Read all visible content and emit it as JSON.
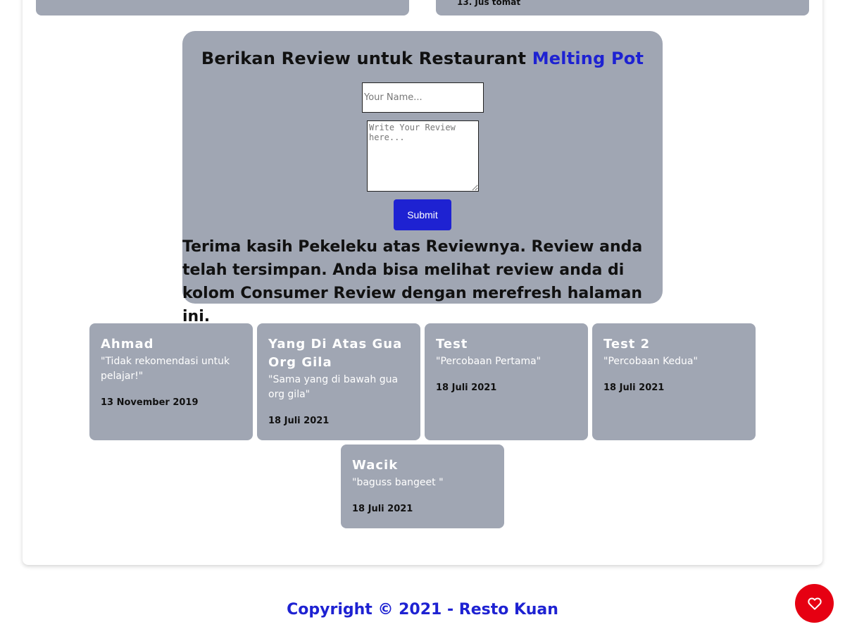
{
  "top_panels": {
    "right_snippet": "13. Jus tomat"
  },
  "review_form": {
    "title_prefix": "Berikan Review untuk Restaurant",
    "restaurant_name": "Melting Pot",
    "name_placeholder": "Your Name...",
    "review_placeholder": "Write Your Review here...",
    "submit_label": "Submit",
    "thanks_message": "Terima kasih Pekeleku atas Reviewnya. Review anda telah tersimpan. Anda bisa melihat review anda di kolom Consumer Review dengan merefresh halaman ini."
  },
  "reviews": [
    {
      "name": "Ahmad",
      "text": "\"Tidak rekomendasi untuk pelajar!\"",
      "date": "13 November 2019"
    },
    {
      "name": "Yang Di Atas Gua Org Gila",
      "text": "\"Sama yang di bawah gua org gila\"",
      "date": "18 Juli 2021"
    },
    {
      "name": "Test",
      "text": "\"Percobaan Pertama\"",
      "date": "18 Juli 2021"
    },
    {
      "name": "Test 2",
      "text": "\"Percobaan Kedua\"",
      "date": "18 Juli 2021"
    },
    {
      "name": "Wacik",
      "text": "\"baguss bangeet \"",
      "date": "18 Juli 2021"
    }
  ],
  "footer": {
    "copyright": "Copyright © 2021 - Resto Kuan"
  },
  "favorite_button": {
    "icon": "heart-icon"
  },
  "colors": {
    "accent": "#1e22d2",
    "panel": "#a0a6b3",
    "favorite": "#e60012"
  }
}
